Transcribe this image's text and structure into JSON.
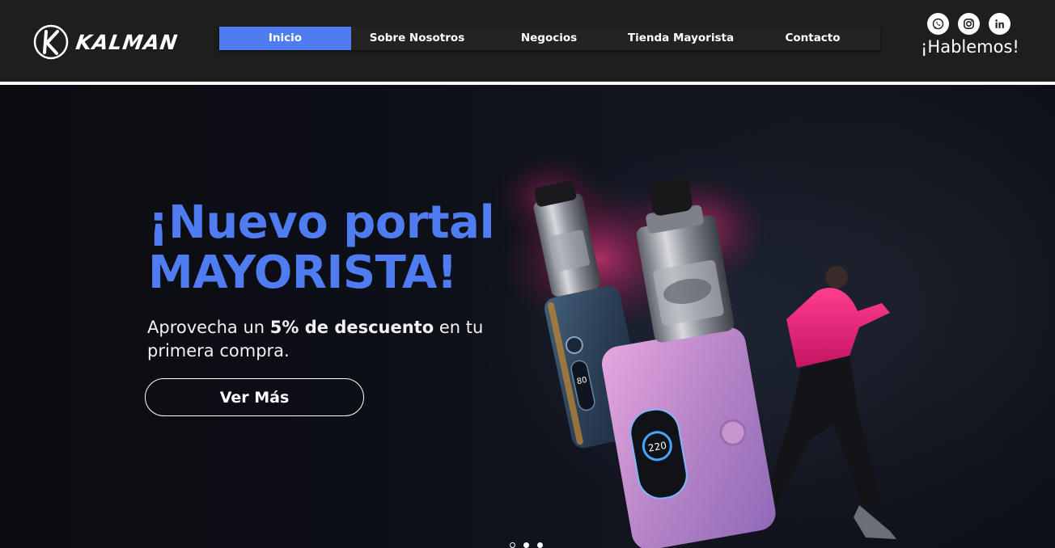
{
  "brand": {
    "name": "KALMAN"
  },
  "nav": {
    "items": [
      {
        "label": "Inicio",
        "active": true
      },
      {
        "label": "Sobre Nosotros",
        "active": false
      },
      {
        "label": "Negocios",
        "active": false
      },
      {
        "label": "Tienda Mayorista",
        "active": false
      },
      {
        "label": "Contacto",
        "active": false
      }
    ]
  },
  "social": {
    "icons": [
      "whatsapp-icon",
      "instagram-icon",
      "linkedin-icon"
    ],
    "cta_label": "¡Hablemos!"
  },
  "hero": {
    "headline_line1": "¡Nuevo portal",
    "headline_line2": "MAYORISTA!",
    "sub_pre": "Aprovecha un ",
    "sub_bold": "5% de descuento",
    "sub_post": " en tu primera compra.",
    "button_label": "Ver Más",
    "device_screen_small": "80",
    "device_screen_large": "220",
    "slides_total": 3,
    "slide_active": 1
  },
  "colors": {
    "accent": "#4f7cf0",
    "header_bg": "#1e1e1e",
    "hero_bg": "#0d0f16",
    "text": "#ffffff"
  }
}
